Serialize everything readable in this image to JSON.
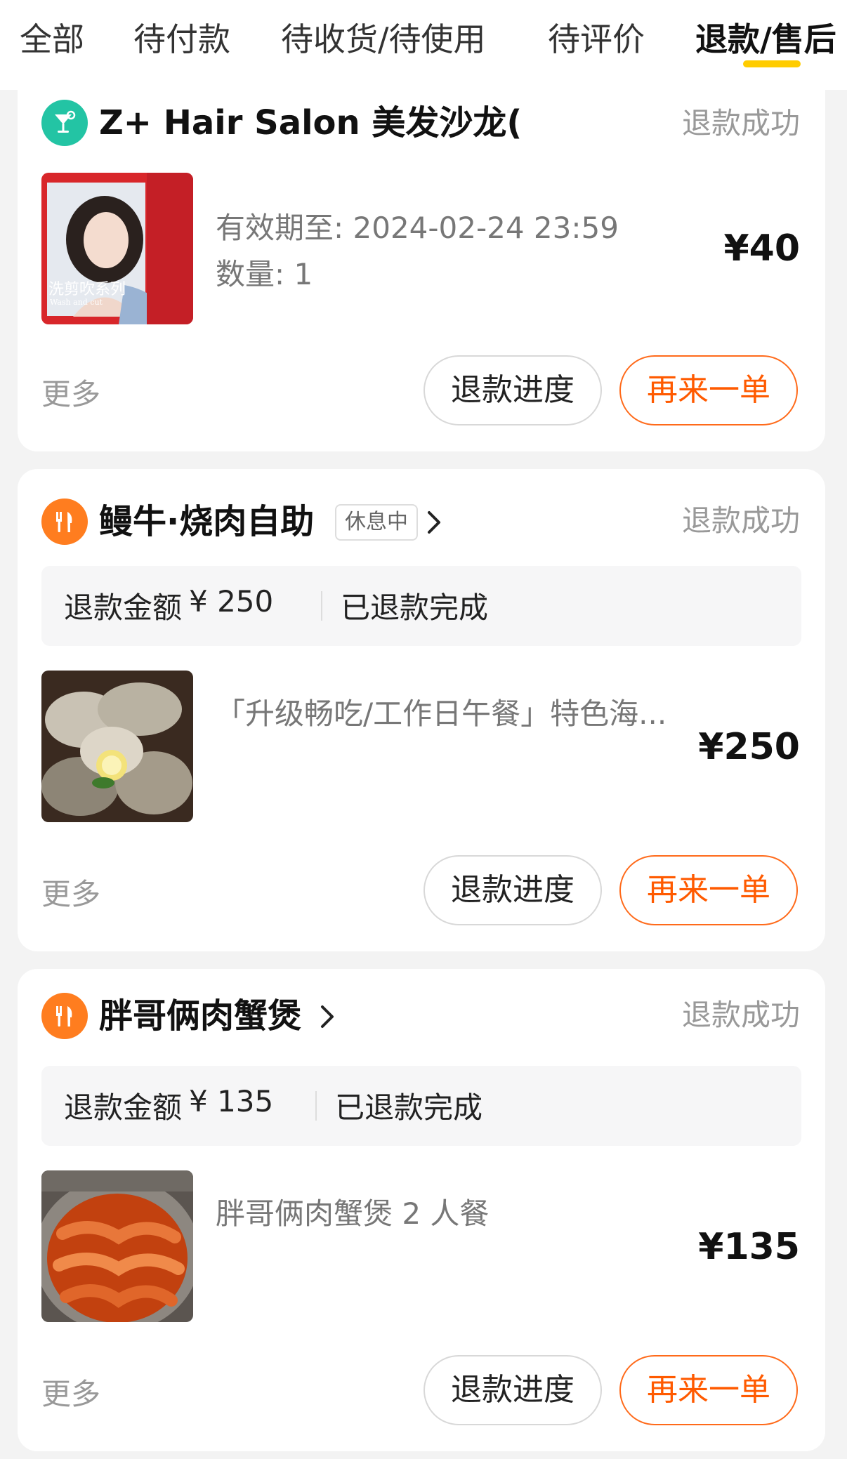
{
  "tabs": [
    {
      "label": "全部"
    },
    {
      "label": "待付款"
    },
    {
      "label": "待收货/待使用"
    },
    {
      "label": "待评价"
    },
    {
      "label": "退款/售后"
    }
  ],
  "active_tab_index": 4,
  "colors": {
    "accent_underline": "#ffcc00",
    "reorder_button": "#ff5a00",
    "salon_icon": "#23c4a4",
    "food_icon": "#ff7d1f"
  },
  "orders": [
    {
      "shop_name": "Z+ Hair Salon 美发沙龙(陈桥店)...",
      "shop_icon": "cocktail-glass-icon",
      "status": "退款成功",
      "thumb_caption_cn": "洗剪吹系列",
      "thumb_caption_en": "Wash and cut",
      "valid_until": "有效期至: 2024-02-24 23:59",
      "quantity": "数量: 1",
      "price": "¥40",
      "more_label": "更多",
      "progress_label": "退款进度",
      "reorder_label": "再来一单"
    },
    {
      "shop_name": "鳗牛·烧肉自助",
      "shop_icon": "fork-knife-icon",
      "shop_tag": "休息中",
      "status": "退款成功",
      "refund_label": "退款金额",
      "refund_amount": "¥ 250",
      "refund_state": "已退款完成",
      "item_title": "「升级畅吃/工作日午餐」特色海...",
      "price": "¥250",
      "more_label": "更多",
      "progress_label": "退款进度",
      "reorder_label": "再来一单"
    },
    {
      "shop_name": "胖哥俩肉蟹煲",
      "shop_icon": "fork-knife-icon",
      "status": "退款成功",
      "refund_label": "退款金额",
      "refund_amount": "¥ 135",
      "refund_state": "已退款完成",
      "item_title": "胖哥俩肉蟹煲 2 人餐",
      "price": "¥135",
      "more_label": "更多",
      "progress_label": "退款进度",
      "reorder_label": "再来一单"
    }
  ]
}
